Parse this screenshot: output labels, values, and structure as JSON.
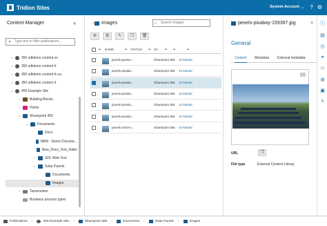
{
  "app": {
    "title": "Tridion Sites",
    "account": "System Account"
  },
  "left_panel": {
    "title": "Content Manager",
    "filter_placeholder": "Type text to filter publications...",
    "tree": [
      {
        "label": "350 sdldemo content es",
        "icon": "publication-icon",
        "chev": "›"
      },
      {
        "label": "350 sdldemo content fr",
        "icon": "publication-icon",
        "chev": "›"
      },
      {
        "label": "350 sdldemo content fr-ca",
        "icon": "publication-icon",
        "chev": "›"
      },
      {
        "label": "350 sdldemo content it",
        "icon": "publication-icon",
        "chev": "›"
      },
      {
        "label": "400 Example Site",
        "icon": "publication-icon",
        "chev": "⌄"
      },
      {
        "label": "Building Blocks",
        "icon": "folder-icon",
        "chev": "›"
      },
      {
        "label": "Home",
        "icon": "structure-group-icon",
        "chev": "›"
      },
      {
        "label": "Sharepoint 365",
        "icon": "sharepoint-folder-icon",
        "chev": "⌄"
      },
      {
        "label": "Documents",
        "icon": "sharepoint-folder-icon",
        "chev": "⌄"
      },
      {
        "label": "Docs",
        "icon": "sharepoint-folder-icon",
        "chev": ""
      },
      {
        "label": "NAW - Demo Docume...",
        "icon": "sharepoint-folder-icon",
        "chev": ""
      },
      {
        "label": "New_Docs_Test_folder",
        "icon": "sharepoint-folder-icon",
        "chev": ""
      },
      {
        "label": "SDL Web Test",
        "icon": "sharepoint-folder-icon",
        "chev": "›"
      },
      {
        "label": "Solar Panels",
        "icon": "sharepoint-folder-icon",
        "chev": "⌄"
      },
      {
        "label": "Documents",
        "icon": "sharepoint-folder-icon",
        "chev": ""
      },
      {
        "label": "Images",
        "icon": "sharepoint-folder-icon",
        "chev": ""
      },
      {
        "label": "Taxonomies",
        "icon": "taxonomy-icon",
        "chev": "›"
      },
      {
        "label": "Business process types",
        "icon": "business-process-icon",
        "chev": ""
      }
    ]
  },
  "middle_panel": {
    "title": "Images",
    "search_placeholder": "Search Images",
    "columns": {
      "name": "NAME",
      "status": "STATUS",
      "source": "SC..."
    },
    "rows": [
      {
        "name": "pexels-gustav...",
        "source": "Sharepoint 365",
        "status": "10 Master",
        "selected": false
      },
      {
        "name": "pexels-pixaba...",
        "source": "Sharepoint 365",
        "status": "10 Master",
        "selected": false
      },
      {
        "name": "pexels-pixaba...",
        "source": "Sharepoint 365",
        "status": "10 Master",
        "selected": true
      },
      {
        "name": "pexels-pixaba...",
        "source": "Sharepoint 365",
        "status": "10 Master",
        "selected": false
      },
      {
        "name": "pexels-pixaba...",
        "source": "Sharepoint 365",
        "status": "10 Master",
        "selected": false
      },
      {
        "name": "pexels-pixaba...",
        "source": "Sharepoint 365",
        "status": "10 Master",
        "selected": false
      },
      {
        "name": "pexels-vivint-s...",
        "source": "Sharepoint 365",
        "status": "10 Master",
        "selected": false
      }
    ]
  },
  "right_panel": {
    "title": "pexels-pixabay-159397.jpg",
    "section": "General",
    "tabs": [
      "Content",
      "Metadata",
      "External metadata"
    ],
    "url_label": "URL",
    "file_type_label": "File type",
    "file_type_value": "External Content Library"
  },
  "breadcrumb": [
    {
      "label": "Publications",
      "icon": "publications-icon"
    },
    {
      "label": "400 Example Site",
      "icon": "publication-icon"
    },
    {
      "label": "Sharepoint 365",
      "icon": "sharepoint-folder-icon"
    },
    {
      "label": "Documents",
      "icon": "sharepoint-folder-icon"
    },
    {
      "label": "Solar Panels",
      "icon": "sharepoint-folder-icon"
    },
    {
      "label": "Images",
      "icon": "sharepoint-folder-icon"
    }
  ],
  "colors": {
    "brand": "#0b6ea8",
    "accent": "#1c6fa8",
    "selected_row": "#d6e6ef"
  }
}
